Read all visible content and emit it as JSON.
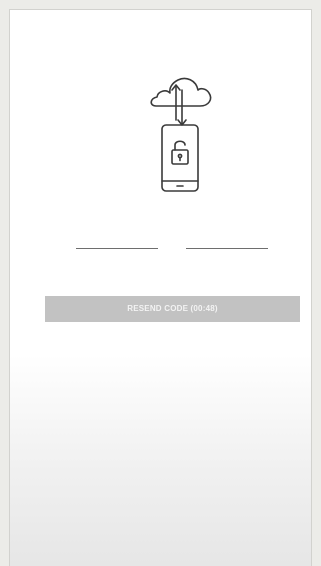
{
  "verification": {
    "illustration_icon": "cloud-sync-phone-lock-icon",
    "code_fields": [
      {
        "value": ""
      },
      {
        "value": ""
      }
    ],
    "resend_button_label": "RESEND CODE (00:48)"
  },
  "colors": {
    "page_background": "#ecece8",
    "panel_background": "#ffffff",
    "button_background": "#c2c2c2",
    "button_text": "#f3f3f3",
    "line_color": "#6e6e6e"
  }
}
